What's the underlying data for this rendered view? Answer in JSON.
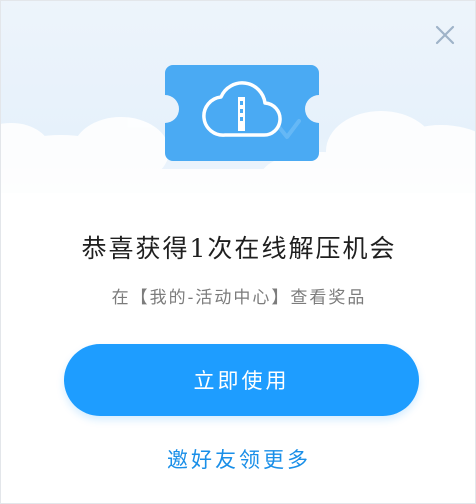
{
  "dialog": {
    "title": "恭喜获得1次在线解压机会",
    "subtitle": "在【我的-活动中心】查看奖品",
    "primary_button_label": "立即使用",
    "secondary_link_label": "邀好友领更多"
  },
  "icons": {
    "close": "close-icon",
    "ticket": "ticket-icon",
    "cloud_archive": "cloud-zip-icon"
  },
  "colors": {
    "accent": "#1e9dff",
    "link": "#1a8fe8",
    "ticket": "#4aaaf3",
    "hero_bg": "#e6f1fb"
  }
}
